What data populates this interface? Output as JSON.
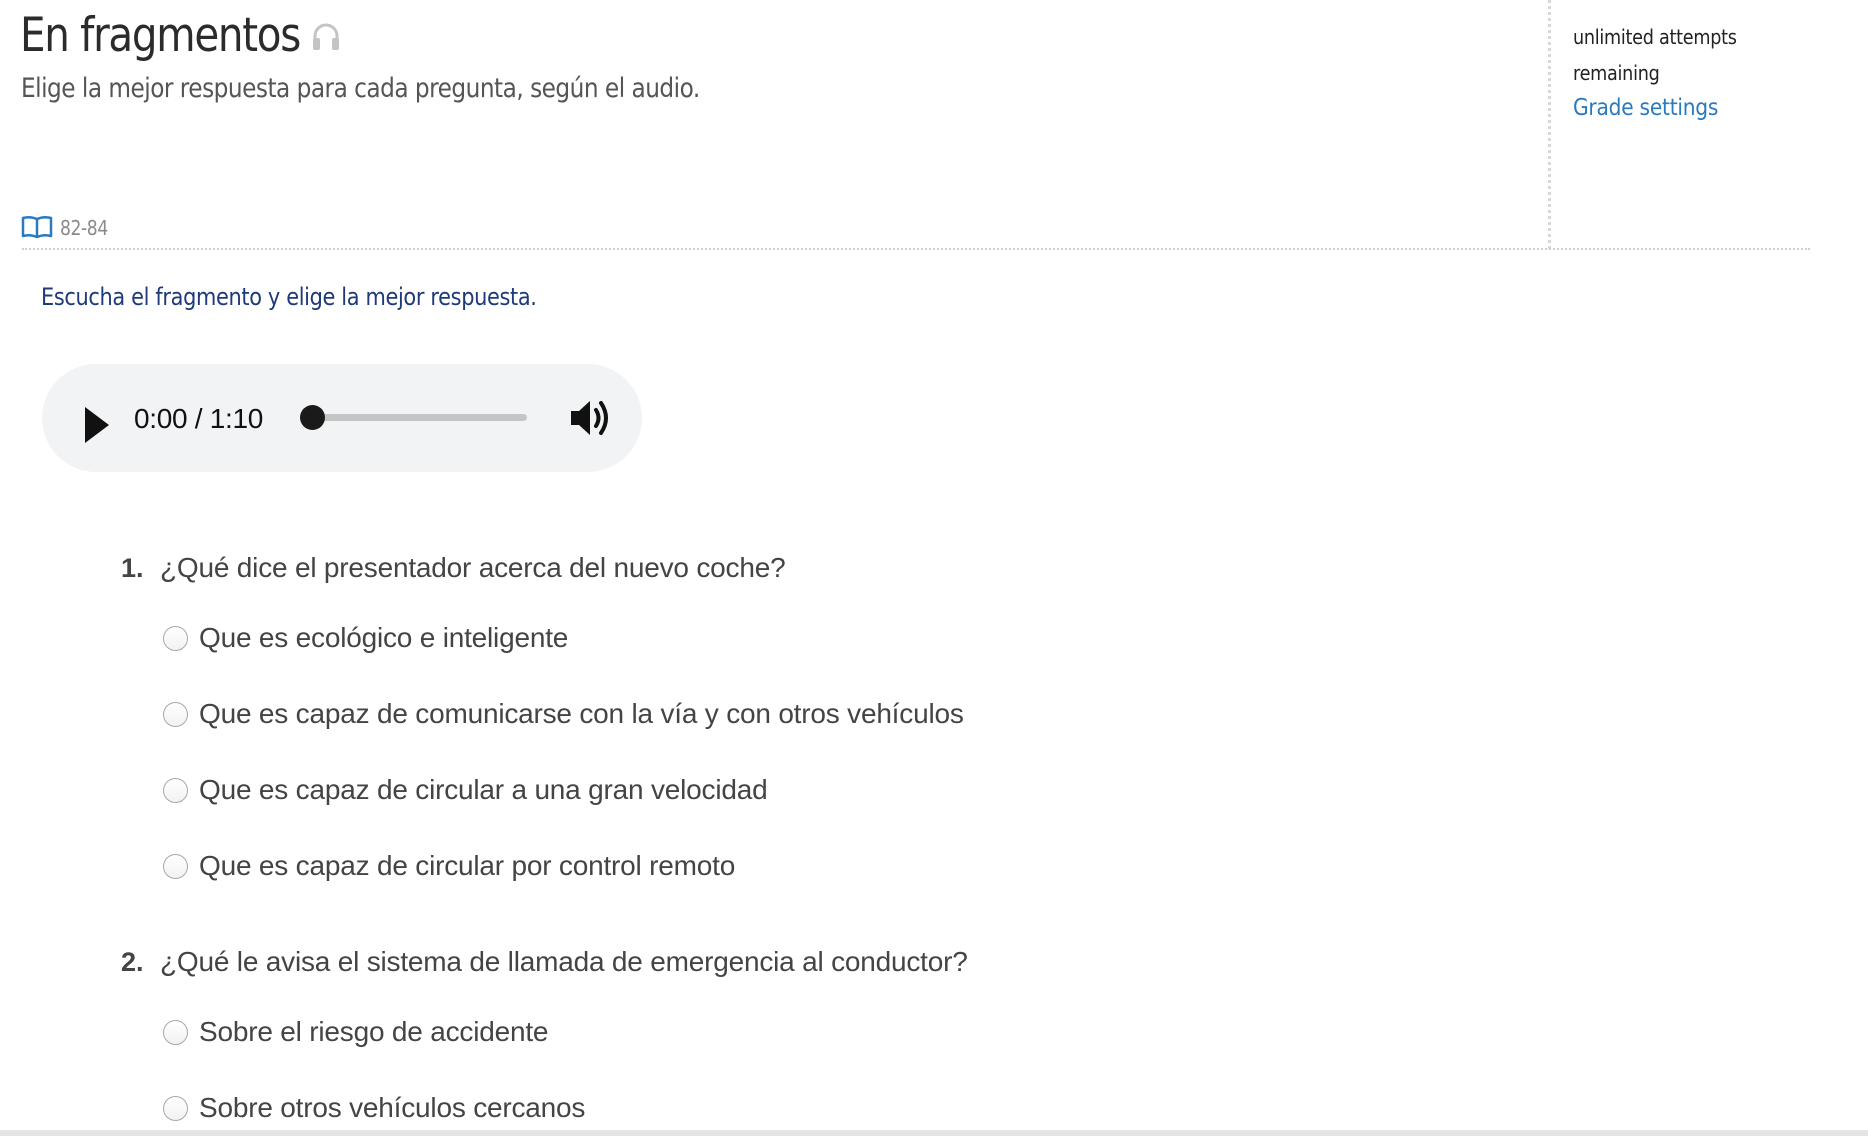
{
  "header": {
    "title": "En fragmentos",
    "title_icon": "headphones-icon",
    "subtitle": "Elige la mejor respuesta para cada pregunta, según el audio.",
    "page_reference_icon": "book-icon",
    "page_reference": "82-84"
  },
  "side_panel": {
    "attempts_line1": "unlimited attempts",
    "attempts_line2": "remaining",
    "grade_settings_link": "Grade settings"
  },
  "instruction": "Escucha el fragmento y elige la mejor respuesta.",
  "audio_player": {
    "play_icon": "play-icon",
    "current_time": "0:00",
    "duration": "1:10",
    "time_display": "0:00 / 1:10",
    "progress_fraction": 0,
    "volume_icon": "volume-icon"
  },
  "questions": [
    {
      "number": "1.",
      "text": "¿Qué dice el presentador acerca del nuevo coche?",
      "options": [
        "Que es ecológico e inteligente",
        "Que es capaz de comunicarse con la vía y con otros vehículos",
        "Que es capaz de circular a una gran velocidad",
        "Que es capaz de circular por control remoto"
      ]
    },
    {
      "number": "2.",
      "text": "¿Qué le avisa el sistema de llamada de emergencia al conductor?",
      "options": [
        "Sobre el riesgo de accidente",
        "Sobre otros vehículos cercanos"
      ]
    }
  ],
  "colors": {
    "link": "#2a7abf",
    "instruction": "#1f3a7a",
    "player_background": "#f1f3f4"
  }
}
